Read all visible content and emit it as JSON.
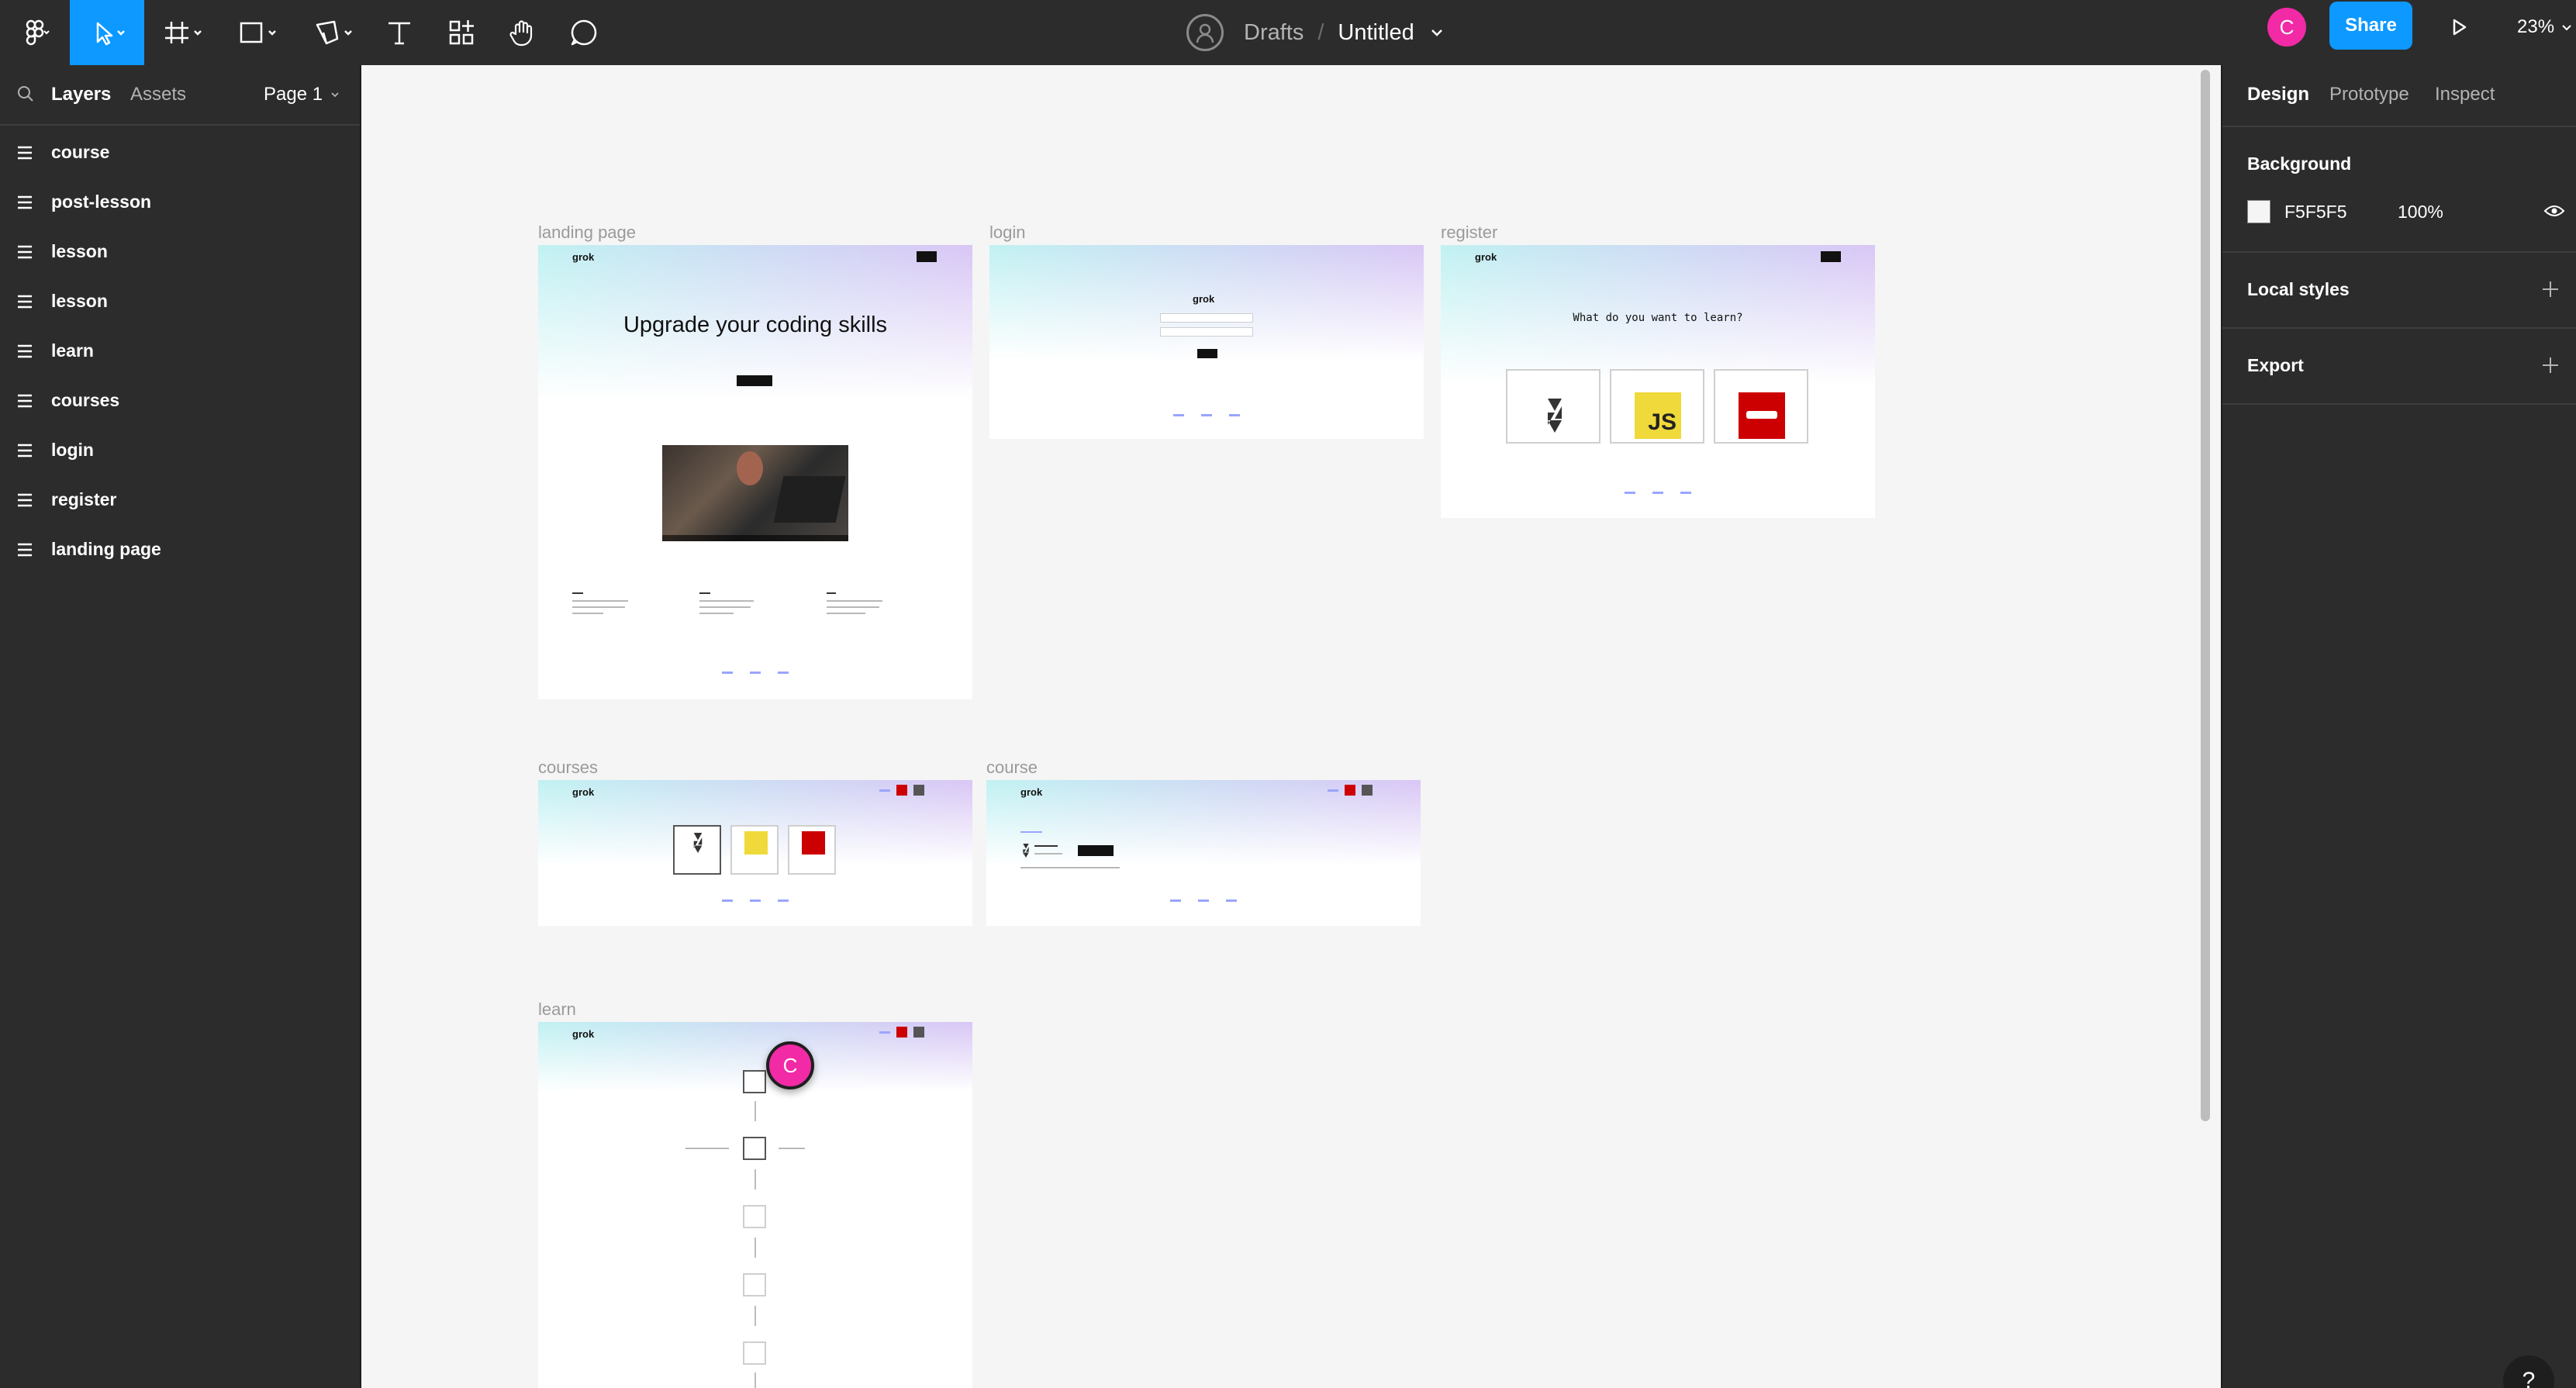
{
  "toolbar": {
    "file_location": "Drafts",
    "separator": "/",
    "file_name": "Untitled",
    "user_initial": "C",
    "share_label": "Share",
    "zoom_level": "23%",
    "accent_color": "#0d99ff",
    "avatar_color": "#f22aa6"
  },
  "left_panel": {
    "tabs": [
      "Layers",
      "Assets"
    ],
    "page_selector": "Page 1",
    "layers": [
      "course",
      "post-lesson",
      "lesson",
      "lesson",
      "learn",
      "courses",
      "login",
      "register",
      "landing page"
    ]
  },
  "right_panel": {
    "tabs": [
      "Design",
      "Prototype",
      "Inspect"
    ],
    "background_label": "Background",
    "background_hex": "F5F5F5",
    "background_opacity": "100%",
    "local_styles_label": "Local styles",
    "export_label": "Export"
  },
  "canvas": {
    "frames": {
      "landing": {
        "label": "landing page",
        "logo": "grok",
        "hero": "Upgrade your coding skills"
      },
      "login": {
        "label": "login",
        "logo": "grok"
      },
      "register": {
        "label": "register",
        "logo": "grok",
        "question": "What do you want to learn?",
        "cards": [
          "JS"
        ]
      },
      "courses": {
        "label": "courses",
        "logo": "grok"
      },
      "course": {
        "label": "course",
        "logo": "grok"
      },
      "learn": {
        "label": "learn",
        "logo": "grok"
      }
    },
    "collaborator_initial": "C",
    "help_label": "?"
  }
}
